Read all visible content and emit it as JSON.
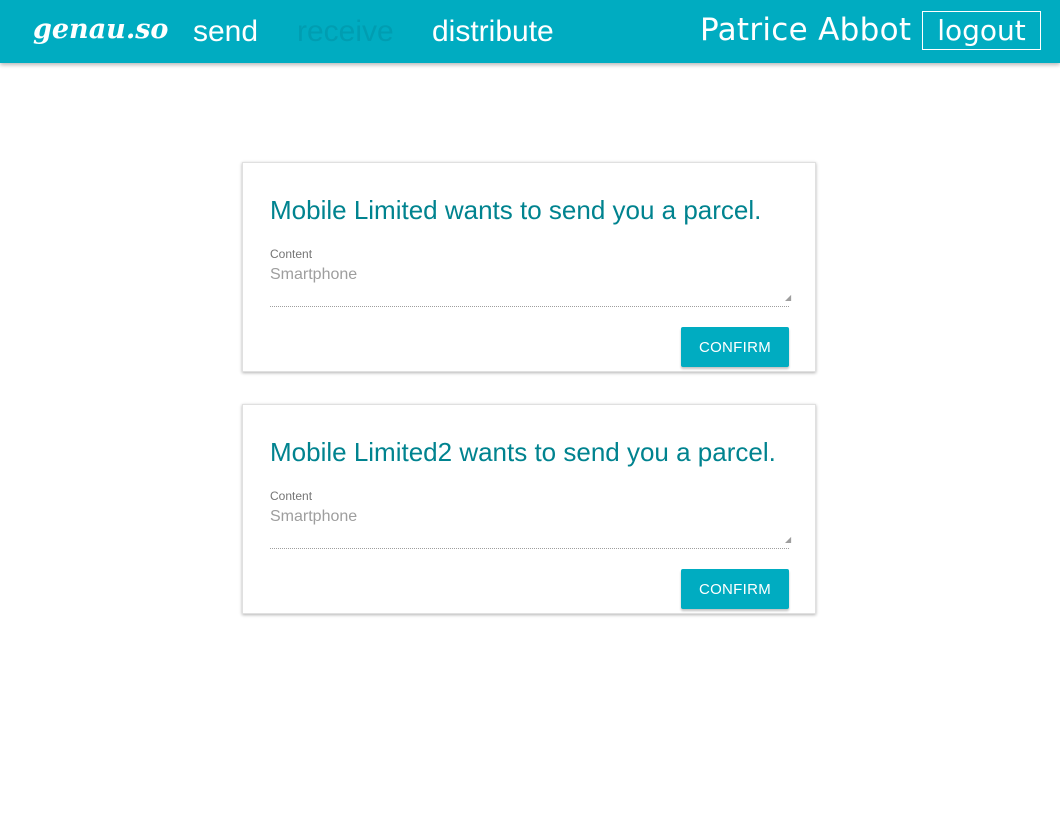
{
  "header": {
    "logo": "genau.so",
    "nav": [
      {
        "label": "send",
        "active": false
      },
      {
        "label": "receive",
        "active": true
      },
      {
        "label": "distribute",
        "active": false
      }
    ],
    "user_name": "Patrice Abbot",
    "logout_label": "logout"
  },
  "parcels": [
    {
      "title": "Mobile Limited wants to send you a parcel.",
      "content_label": "Content",
      "content_value": "Smartphone",
      "confirm_label": "Confirm"
    },
    {
      "title": "Mobile Limited2 wants to send you a parcel.",
      "content_label": "Content",
      "content_value": "Smartphone",
      "confirm_label": "Confirm"
    }
  ],
  "colors": {
    "brand": "#00acc1",
    "title_text": "#00838f",
    "active_nav": "#19b3c6"
  }
}
